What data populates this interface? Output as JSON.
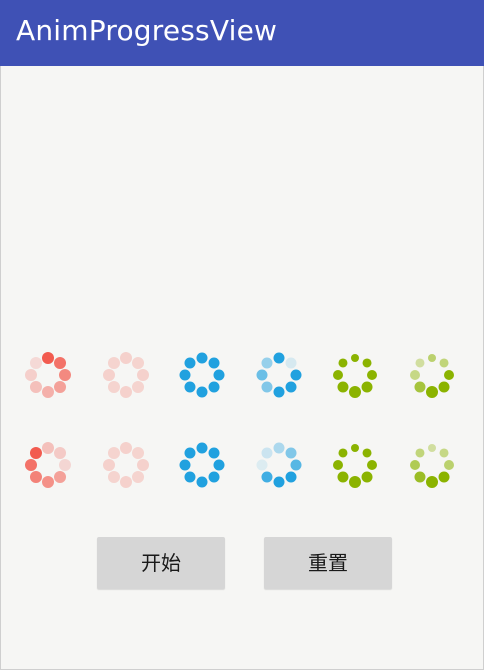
{
  "app": {
    "title": "AnimProgressView"
  },
  "colors": {
    "appbar": "#3f51b5",
    "red": "#f25b4f",
    "blue": "#21a1df",
    "green": "#8bb300"
  },
  "spinners": [
    {
      "name": "red-spinner-1",
      "row": 1,
      "col": 1,
      "color": "#f25b4f",
      "opacities": [
        1,
        0.85,
        0.7,
        0.55,
        0.45,
        0.35,
        0.25,
        0.18
      ]
    },
    {
      "name": "red-spinner-2",
      "row": 1,
      "col": 2,
      "color": "#f25b4f",
      "opacities": [
        0.24,
        0.22,
        0.24,
        0.22,
        0.24,
        0.22,
        0.24,
        0.22
      ]
    },
    {
      "name": "blue-spinner-1",
      "row": 1,
      "col": 3,
      "color": "#21a1df",
      "opacities": [
        1,
        1,
        1,
        1,
        1,
        1,
        1,
        1
      ]
    },
    {
      "name": "blue-spinner-2",
      "row": 1,
      "col": 4,
      "color": "#21a1df",
      "opacities": [
        1,
        0.15,
        1,
        1,
        1,
        0.55,
        0.65,
        0.45
      ]
    },
    {
      "name": "green-spinner-1",
      "row": 1,
      "col": 5,
      "color": "#8bb300",
      "opacities": [
        1,
        1,
        1,
        1,
        1,
        1,
        1,
        1
      ]
    },
    {
      "name": "green-spinner-2",
      "row": 1,
      "col": 6,
      "color": "#8bb300",
      "opacities": [
        0.55,
        0.5,
        1,
        1,
        1,
        0.75,
        0.45,
        0.35
      ]
    },
    {
      "name": "red-spinner-3",
      "row": 2,
      "col": 1,
      "color": "#f25b4f",
      "opacities": [
        0.35,
        0.28,
        0.2,
        0.55,
        0.65,
        0.75,
        0.85,
        1
      ]
    },
    {
      "name": "red-spinner-4",
      "row": 2,
      "col": 2,
      "color": "#f25b4f",
      "opacities": [
        0.24,
        0.22,
        0.24,
        0.22,
        0.24,
        0.22,
        0.24,
        0.22
      ]
    },
    {
      "name": "blue-spinner-3",
      "row": 2,
      "col": 3,
      "color": "#21a1df",
      "opacities": [
        1,
        1,
        1,
        1,
        1,
        1,
        1,
        1
      ]
    },
    {
      "name": "blue-spinner-4",
      "row": 2,
      "col": 4,
      "color": "#21a1df",
      "opacities": [
        0.35,
        0.55,
        0.75,
        1,
        1,
        0.85,
        0.12,
        0.2
      ]
    },
    {
      "name": "green-spinner-3",
      "row": 2,
      "col": 5,
      "color": "#8bb300",
      "opacities": [
        1,
        1,
        1,
        1,
        1,
        1,
        1,
        1
      ]
    },
    {
      "name": "green-spinner-4",
      "row": 2,
      "col": 6,
      "color": "#8bb300",
      "opacities": [
        0.35,
        0.45,
        0.55,
        1,
        1,
        0.85,
        0.65,
        0.5
      ]
    }
  ],
  "buttons": {
    "start": "开始",
    "reset": "重置"
  }
}
